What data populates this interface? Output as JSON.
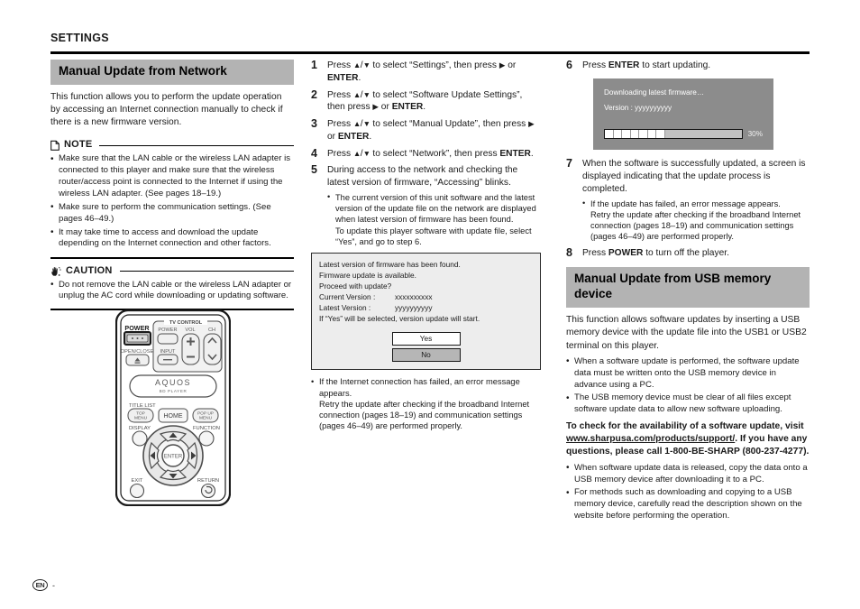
{
  "header": {
    "title": "SETTINGS"
  },
  "left_column": {
    "section_title": "Manual Update from Network",
    "intro": "This function allows you to perform the update operation by accessing an Internet connection manually to check if there is a new firmware version.",
    "note": {
      "label": "NOTE",
      "icon": "note-page-icon",
      "bullets": [
        "Make sure that the LAN cable or the wireless LAN adapter is connected to this player and make sure that the wireless router/access point is connected to the Internet if using the wireless LAN adapter. (See pages 18–19.)",
        "Make sure to perform the communication settings. (See pages 46–49.)",
        "It may take time to access and download the update depending on the Internet connection and other factors."
      ]
    },
    "caution": {
      "label": "CAUTION",
      "icon": "caution-hand-icon",
      "bullets": [
        "Do not remove the LAN cable or the wireless LAN adapter or unplug the AC cord while downloading or updating software."
      ]
    },
    "remote": {
      "power_label": "POWER",
      "open_close_label": "OPEN/CLOSE",
      "tv_control_label": "TV CONTROL",
      "tv_power_label": "POWER",
      "vol_label": "VOL",
      "ch_label": "CH",
      "input_label": "INPUT",
      "vol_plus": "+",
      "vol_minus": "−",
      "brand": "AQUOS",
      "brand_sub": "BD PLAYER",
      "title_list_label": "TITLE LIST",
      "top_menu_label": "TOP\nMENU",
      "home_label": "HOME",
      "popup_menu_label": "POP UP\nMENU",
      "display_label": "DISPLAY",
      "function_label": "FUNCTION",
      "enter_label": "ENTER",
      "exit_label": "EXIT",
      "return_label": "RETURN"
    }
  },
  "middle_column": {
    "steps": [
      {
        "num": "1",
        "parts": [
          "Press ",
          "▲",
          "/",
          "▼",
          " to select “Settings”, then press ",
          "▶",
          " or ",
          "ENTER",
          "."
        ],
        "text": "Press ▲/▼ to select “Settings”, then press ▶ or ENTER."
      },
      {
        "num": "2",
        "text": "Press ▲/▼ to select “Software Update Settings”, then press ▶ or ENTER."
      },
      {
        "num": "3",
        "text": "Press ▲/▼ to select “Manual Update”, then press ▶ or ENTER."
      },
      {
        "num": "4",
        "text": "Press ▲/▼ to select “Network”, then press ENTER."
      },
      {
        "num": "5",
        "text": "During access to the network and checking the latest version of firmware, “Accessing” blinks."
      }
    ],
    "step5_bullet_1": "The current version of this unit software and the latest version of the update file on the network are displayed when latest version of firmware has been found.",
    "step5_bullet_1_cont": "To update this player software with update file, select “Yes”, and go to step 6.",
    "firmware_dialog": {
      "line1": "Latest version of firmware has been found.",
      "line2": "Firmware update is available.",
      "line3": "Proceed with update?",
      "current_version_label": "Current Version :",
      "current_version_value": "xxxxxxxxxx",
      "latest_version_label": "Latest Version  :",
      "latest_version_value": "yyyyyyyyyy",
      "note_line": "If “Yes” will be selected, version update will start.",
      "yes_button": "Yes",
      "no_button": "No"
    },
    "after_dialog_bullet": "If the Internet connection has failed, an error message appears.",
    "after_dialog_bullet_cont": "Retry the update after checking if the broadband Internet connection (pages 18–19) and communication settings (pages 46–49) are performed properly."
  },
  "right_column": {
    "step6": {
      "num": "6",
      "text": "Press ENTER to start updating."
    },
    "download_dialog": {
      "line1": "Downloading latest firmware…",
      "version_label": "Version :",
      "version_value": "yyyyyyyyyy",
      "percent": "30%",
      "progress_segments": 7
    },
    "step7": {
      "num": "7",
      "text": "When the software is successfully updated, a screen is displayed indicating that the update process is completed.",
      "bullet": "If the update has failed, an error message appears.",
      "bullet_cont": "Retry the update after checking if the broadband Internet connection (pages 18–19) and communication settings (pages 46–49) are performed properly."
    },
    "step8": {
      "num": "8",
      "text": "Press POWER to turn off the player."
    },
    "usb_section": {
      "title": "Manual Update from USB memory device",
      "intro": "This function allows software updates by inserting a USB memory device with the update file into the USB1 or USB2 terminal on this player.",
      "bullets": [
        "When a software update is performed, the software update data must be written onto the USB memory device in advance using a PC.",
        "The USB memory device must be clear of all files except software update data to allow new software uploading."
      ],
      "availability_pre": "To check for the availability of a software update, visit ",
      "availability_link": "www.sharpusa.com/products/support/",
      "availability_post": ". If you have any questions, please call 1-800-BE-SHARP (800-237-4277).",
      "bullets2": [
        "When software update data is released, copy the data onto a USB memory device after downloading it to a PC.",
        "For methods such as downloading and copying to a USB memory device, carefully read the description shown on the website before performing the operation."
      ]
    }
  },
  "footer": {
    "lang_badge": "EN",
    "page_dash": "-"
  }
}
